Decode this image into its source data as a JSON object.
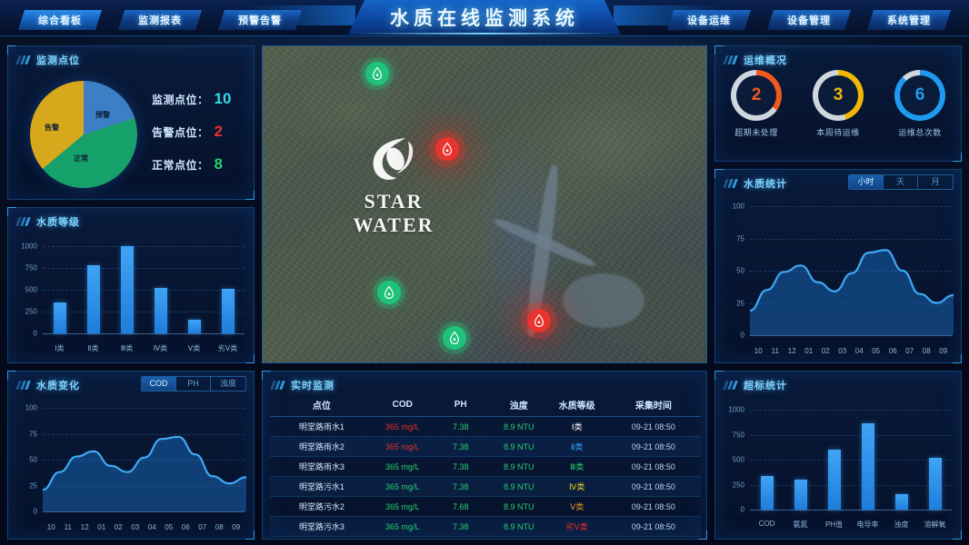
{
  "header": {
    "title": "水质在线监测系统",
    "nav_left": [
      {
        "label": "综合看板",
        "active": true
      },
      {
        "label": "监测报表",
        "active": false
      },
      {
        "label": "预警告警",
        "active": false
      }
    ],
    "nav_right": [
      {
        "label": "设备运维",
        "active": false
      },
      {
        "label": "设备管理",
        "active": false
      },
      {
        "label": "系统管理",
        "active": false
      }
    ]
  },
  "points_panel": {
    "title": "监测点位",
    "pie_labels": {
      "warn": "预警",
      "normal": "正常",
      "alarm": "告警"
    },
    "stats": [
      {
        "label": "监测点位：",
        "value": "10",
        "color": "#2fd9e8"
      },
      {
        "label": "告警点位：",
        "value": "2",
        "color": "#e8302c"
      },
      {
        "label": "正常点位：",
        "value": "8",
        "color": "#25d06f"
      }
    ]
  },
  "grade_panel": {
    "title": "水质等级"
  },
  "change_panel": {
    "title": "水质变化",
    "tabs": [
      {
        "label": "COD",
        "active": true
      },
      {
        "label": "PH",
        "active": false
      },
      {
        "label": "浊度",
        "active": false
      }
    ]
  },
  "map_panel": {
    "logo_name": "STAR WATER",
    "markers": [
      {
        "type": "normal",
        "x": 113,
        "y": 17,
        "color": "#1fc27a"
      },
      {
        "type": "alarm",
        "x": 190,
        "y": 100,
        "color": "#e8342c"
      },
      {
        "type": "normal",
        "x": 126,
        "y": 258,
        "color": "#1fc27a"
      },
      {
        "type": "normal",
        "x": 198,
        "y": 308,
        "color": "#1fc27a"
      },
      {
        "type": "alarm",
        "x": 291,
        "y": 289,
        "color": "#e8342c"
      }
    ]
  },
  "ops_panel": {
    "title": "运维概况",
    "gauges": [
      {
        "value": "2",
        "label": "超期未处理",
        "color": "#f05a1e",
        "percent": 35
      },
      {
        "value": "3",
        "label": "本周待运维",
        "color": "#f2b705",
        "percent": 45
      },
      {
        "value": "6",
        "label": "运维总次数",
        "color": "#1e9bf0",
        "percent": 88
      }
    ]
  },
  "wqstat_panel": {
    "title": "水质统计",
    "tabs": [
      {
        "label": "小时",
        "active": true
      },
      {
        "label": "天",
        "active": false
      },
      {
        "label": "月",
        "active": false
      }
    ]
  },
  "exceed_panel": {
    "title": "超标统计"
  },
  "realtime_panel": {
    "title": "实时监测",
    "columns": [
      "点位",
      "COD",
      "PH",
      "浊度",
      "水质等级",
      "采集时间"
    ],
    "rows": [
      {
        "site": "明堂路雨水1",
        "cod": "365 mg/L",
        "cod_color": "#e8302c",
        "ph": "7.38",
        "ph_color": "#25d06f",
        "turb": "8.9 NTU",
        "turb_color": "#25d06f",
        "grade": "Ⅰ类",
        "grade_color": "#ffffff",
        "time": "09-21 08:50"
      },
      {
        "site": "明堂路雨水2",
        "cod": "365 mg/L",
        "cod_color": "#e8302c",
        "ph": "7.38",
        "ph_color": "#25d06f",
        "turb": "8.9 NTU",
        "turb_color": "#25d06f",
        "grade": "Ⅱ类",
        "grade_color": "#2fa8ff",
        "time": "09-21 08:50"
      },
      {
        "site": "明堂路雨水3",
        "cod": "365 mg/L",
        "cod_color": "#25d06f",
        "ph": "7.38",
        "ph_color": "#25d06f",
        "turb": "8.9 NTU",
        "turb_color": "#25d06f",
        "grade": "Ⅲ类",
        "grade_color": "#25d06f",
        "time": "09-21 08:50"
      },
      {
        "site": "明堂路污水1",
        "cod": "365 mg/L",
        "cod_color": "#25d06f",
        "ph": "7.38",
        "ph_color": "#25d06f",
        "turb": "8.9 NTU",
        "turb_color": "#25d06f",
        "grade": "Ⅳ类",
        "grade_color": "#e8d41c",
        "time": "09-21 08:50"
      },
      {
        "site": "明堂路污水2",
        "cod": "365 mg/L",
        "cod_color": "#25d06f",
        "ph": "7.68",
        "ph_color": "#25d06f",
        "turb": "8.9 NTU",
        "turb_color": "#25d06f",
        "grade": "Ⅴ类",
        "grade_color": "#f0952a",
        "time": "09-21 08:50"
      },
      {
        "site": "明堂路污水3",
        "cod": "365 mg/L",
        "cod_color": "#25d06f",
        "ph": "7.38",
        "ph_color": "#25d06f",
        "turb": "8.9 NTU",
        "turb_color": "#25d06f",
        "grade": "劣Ⅴ类",
        "grade_color": "#e8302c",
        "time": "09-21 08:50"
      }
    ]
  },
  "chart_data": [
    {
      "id": "points_pie",
      "type": "pie",
      "title": "监测点位",
      "categories": [
        "预警",
        "正常",
        "告警"
      ],
      "values": [
        20,
        44,
        36
      ],
      "colors": [
        "#3d7fc4",
        "#16a06a",
        "#d8a81c"
      ],
      "legend": "inside-slices"
    },
    {
      "id": "grade_bar",
      "type": "bar",
      "title": "水质等级",
      "categories": [
        "Ⅰ类",
        "Ⅱ类",
        "Ⅲ类",
        "Ⅳ类",
        "Ⅴ类",
        "劣Ⅴ类"
      ],
      "values": [
        350,
        780,
        1000,
        520,
        155,
        515
      ],
      "yticks": [
        0,
        250,
        500,
        750,
        1000
      ],
      "ylim": [
        0,
        1000
      ],
      "xlabel": "",
      "ylabel": "",
      "grid": true
    },
    {
      "id": "quality_change_area",
      "type": "area",
      "title": "水质变化",
      "x": [
        "10",
        "11",
        "12",
        "01",
        "02",
        "03",
        "04",
        "05",
        "06",
        "07",
        "08",
        "09"
      ],
      "values": [
        21,
        38,
        53,
        58,
        44,
        38,
        52,
        70,
        72,
        55,
        34,
        27,
        33
      ],
      "yticks": [
        0,
        25,
        50,
        75,
        100
      ],
      "ylim": [
        0,
        100
      ],
      "grid": true,
      "series_name": "COD"
    },
    {
      "id": "quality_stat_area",
      "type": "area",
      "title": "水质统计",
      "x": [
        "10",
        "11",
        "12",
        "01",
        "02",
        "03",
        "04",
        "05",
        "06",
        "07",
        "08",
        "09"
      ],
      "values": [
        19,
        35,
        49,
        54,
        41,
        34,
        48,
        64,
        66,
        50,
        32,
        25,
        31
      ],
      "yticks": [
        0,
        25,
        50,
        75,
        100
      ],
      "ylim": [
        0,
        100
      ],
      "grid": true,
      "series_name": "小时"
    },
    {
      "id": "exceed_bar",
      "type": "bar",
      "title": "超标统计",
      "categories": [
        "COD",
        "氨氮",
        "PH值",
        "电导率",
        "浊度",
        "溶解氧"
      ],
      "values": [
        340,
        300,
        600,
        860,
        155,
        520
      ],
      "yticks": [
        0,
        250,
        500,
        750,
        1000
      ],
      "ylim": [
        0,
        1000
      ],
      "grid": true
    }
  ]
}
